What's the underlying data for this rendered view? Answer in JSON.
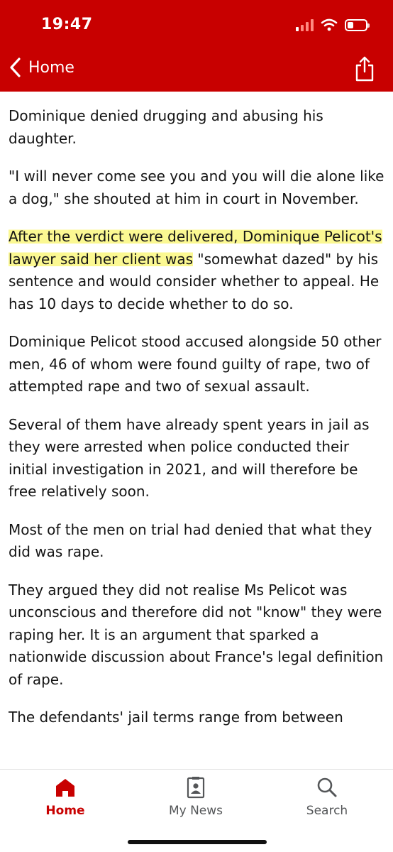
{
  "status_bar": {
    "time": "19:47"
  },
  "nav": {
    "back_label": "Home"
  },
  "article": {
    "paragraphs": [
      "Dominique denied drugging and abusing his daughter.",
      "\"I will never come see you and you will die alone like a dog,\" she shouted at him in court in November.",
      "Dominique Pelicot stood accused alongside 50 other men, 46 of whom were found guilty of rape, two of attempted rape and two of sexual assault.",
      "Several of them have already spent years in jail as they were arrested when police conducted their initial investigation in 2021, and will therefore be free relatively soon.",
      "Most of the men on trial had denied that what they did was rape.",
      "They argued they did not realise Ms Pelicot was unconscious and therefore did not \"know\" they were raping her. It is an argument that sparked a nationwide discussion about France's legal definition of rape.",
      "The defendants' jail terms range from between"
    ],
    "highlighted_paragraph": {
      "highlighted": "After the verdict were delivered, Dominique Pelicot's lawyer said her client was",
      "rest": " \"somewhat dazed\" by his sentence and would consider whether to appeal. He has 10 days to decide whether to do so."
    },
    "highlight_color": "#f7f06a"
  },
  "tabbar": {
    "tabs": [
      {
        "label": "Home",
        "icon": "home-icon",
        "active": true
      },
      {
        "label": "My News",
        "icon": "my-news-icon",
        "active": false
      },
      {
        "label": "Search",
        "icon": "search-icon",
        "active": false
      }
    ]
  },
  "colors": {
    "brand_red": "#c80000",
    "text": "#141414",
    "tab_inactive": "#545658"
  }
}
